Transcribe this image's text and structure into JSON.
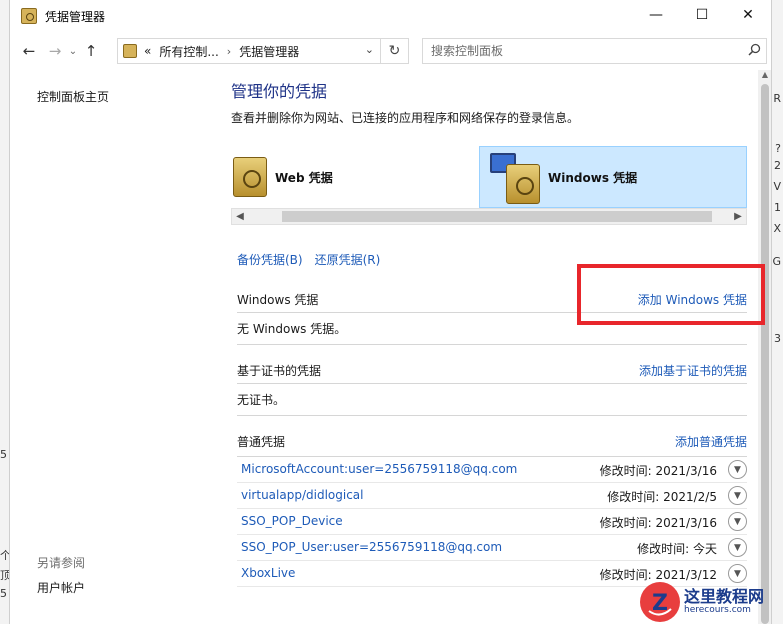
{
  "window": {
    "title": "凭据管理器",
    "controls": {
      "minimize": "—",
      "maximize": "☐",
      "close": "✕"
    }
  },
  "nav": {
    "back": "←",
    "forward": "→",
    "recent": "⌄",
    "up": "↑",
    "address": {
      "overflow": "«",
      "segments": [
        "所有控制...",
        "凭据管理器"
      ],
      "separator": "›",
      "dropdown": "⌄",
      "refresh": "↻"
    },
    "search": {
      "placeholder": "搜索控制面板",
      "icon": "search-icon"
    }
  },
  "sidebar": {
    "home_link": "控制面板主页",
    "see_also_heading": "另请参阅",
    "user_accounts_link": "用户帐户"
  },
  "main": {
    "title": "管理你的凭据",
    "description": "查看并删除你为网站、已连接的应用程序和网络保存的登录信息。",
    "tabs": [
      {
        "label": "Web 凭据",
        "selected": false
      },
      {
        "label": "Windows 凭据",
        "selected": true
      }
    ],
    "backup_link": "备份凭据(B)",
    "restore_link": "还原凭据(R)",
    "windows_section": {
      "label": "Windows 凭据",
      "add_link": "添加 Windows 凭据",
      "empty_text": "无 Windows 凭据。"
    },
    "cert_section": {
      "label": "基于证书的凭据",
      "add_link": "添加基于证书的凭据",
      "empty_text": "无证书。"
    },
    "generic_section": {
      "label": "普通凭据",
      "add_link": "添加普通凭据",
      "modified_prefix": "修改时间:",
      "items": [
        {
          "name": "MicrosoftAccount:user=2556759118@qq.com",
          "modified": "2021/3/16"
        },
        {
          "name": "virtualapp/didlogical",
          "modified": "2021/2/5"
        },
        {
          "name": "SSO_POP_Device",
          "modified": "2021/3/16"
        },
        {
          "name": "SSO_POP_User:user=2556759118@qq.com",
          "modified": "今天"
        },
        {
          "name": "XboxLive",
          "modified": "2021/3/12"
        }
      ]
    }
  },
  "watermark": {
    "cn": "这里教程网",
    "en": "herecours.com"
  },
  "colors": {
    "accent_link": "#1e5bb8",
    "title_blue": "#1e3287",
    "highlight_red": "#e8262b",
    "tab_selected": "#cce8ff"
  },
  "edge_marks": {
    "right": [
      "R",
      "?",
      "2",
      "V",
      "1",
      "X",
      "G",
      "3"
    ],
    "left": [
      "",
      "",
      "5",
      "个",
      "顶",
      "5"
    ]
  }
}
